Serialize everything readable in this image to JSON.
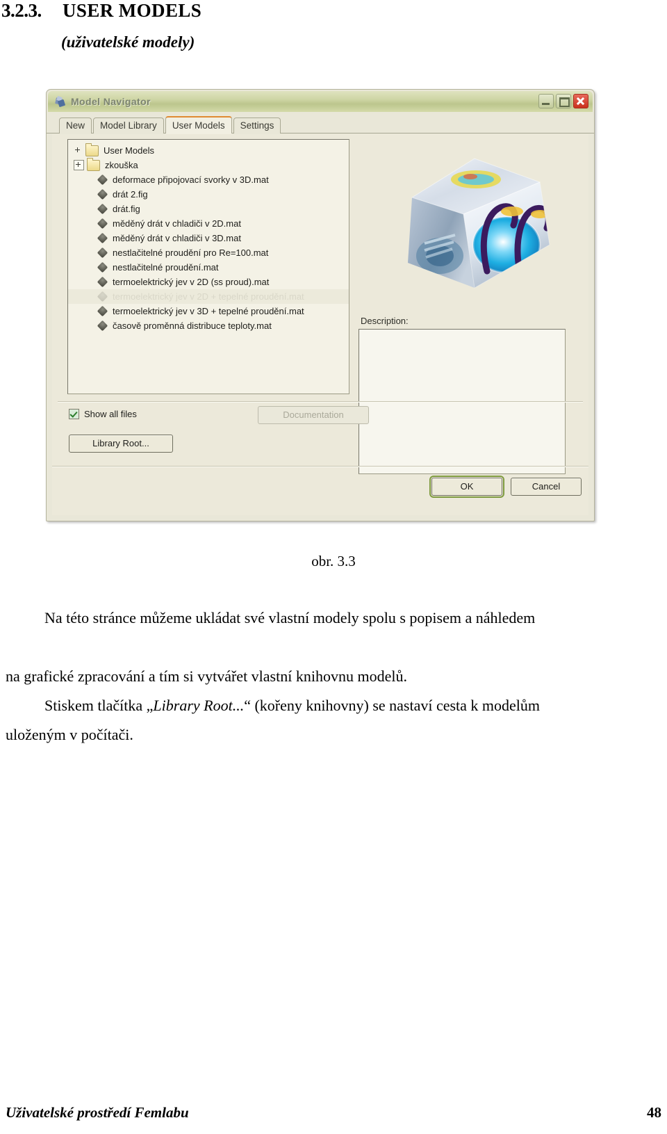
{
  "heading": {
    "number": "3.2.3.",
    "title": "USER MODELS",
    "subtitle": "(uživatelské modely)"
  },
  "dialog": {
    "title": "Model Navigator",
    "title_icon": "model-navigator-icon",
    "window_buttons": {
      "minimize": "minimize-icon",
      "maximize": "maximize-icon",
      "close": "close-icon"
    },
    "tabs": [
      {
        "label": "New",
        "active": false
      },
      {
        "label": "Model Library",
        "active": false
      },
      {
        "label": "User Models",
        "active": true
      },
      {
        "label": "Settings",
        "active": false
      }
    ],
    "tree": [
      {
        "label": "User Models",
        "type": "folder",
        "level": 0,
        "expander": "none",
        "selected": false
      },
      {
        "label": "zkouška",
        "type": "folder",
        "level": 1,
        "expander": "plus",
        "selected": false
      },
      {
        "label": "deformace připojovací svorky v 3D.mat",
        "type": "file",
        "level": 2,
        "expander": "none",
        "selected": false
      },
      {
        "label": "drát 2.fig",
        "type": "file",
        "level": 2,
        "expander": "none",
        "selected": false
      },
      {
        "label": "drát.fig",
        "type": "file",
        "level": 2,
        "expander": "none",
        "selected": false
      },
      {
        "label": "měděný drát v chladiči v 2D.mat",
        "type": "file",
        "level": 2,
        "expander": "none",
        "selected": false
      },
      {
        "label": "měděný drát v chladiči v 3D.mat",
        "type": "file",
        "level": 2,
        "expander": "none",
        "selected": false
      },
      {
        "label": "nestlačitelné proudění pro Re=100.mat",
        "type": "file",
        "level": 2,
        "expander": "none",
        "selected": false
      },
      {
        "label": "nestlačitelné proudění.mat",
        "type": "file",
        "level": 2,
        "expander": "none",
        "selected": false
      },
      {
        "label": "termoelektrický jev v 2D (ss proud).mat",
        "type": "file",
        "level": 2,
        "expander": "none",
        "selected": false
      },
      {
        "label": "termoelektrický jev v 2D + tepelné proudění.mat",
        "type": "file",
        "level": 2,
        "expander": "none",
        "selected": true
      },
      {
        "label": "termoelektrický jev v 3D + tepelné proudění.mat",
        "type": "file",
        "level": 2,
        "expander": "none",
        "selected": false
      },
      {
        "label": "časově proměnná distribuce teploty.mat",
        "type": "file",
        "level": 2,
        "expander": "none",
        "selected": false
      }
    ],
    "preview": {
      "image_name": "femlab-cube-preview",
      "description_label": "Description:",
      "description_value": ""
    },
    "show_all_files": {
      "label": "Show all files",
      "checked": true
    },
    "buttons": {
      "documentation": "Documentation",
      "documentation_enabled": false,
      "library_root": "Library Root...",
      "ok": "OK",
      "cancel": "Cancel",
      "ok_focused": true
    },
    "colors": {
      "titlebar": "#cfd6a6",
      "active_tab_accent": "#e08a32",
      "close_button": "#c9301d",
      "window_bg": "#e9e7d8",
      "field_bg": "#f4f2e6",
      "focus_outline": "#7e9a3e"
    }
  },
  "caption": "obr. 3.3",
  "paragraphs": {
    "p1": "Na této stránce můžeme ukládat své vlastní modely spolu s popisem a náhledem",
    "p1b": "na grafické zpracování a tím si vytvářet vlastní knihovnu modelů.",
    "p2_before": "Stiskem tlačítka „",
    "p2_italic": "Library Root...",
    "p2_after": "“ (kořeny knihovny) se nastaví cesta k modelům",
    "p3": "uloženým v počítači."
  },
  "footer": {
    "text": "Uživatelské prostředí Femlabu",
    "page": "48"
  }
}
